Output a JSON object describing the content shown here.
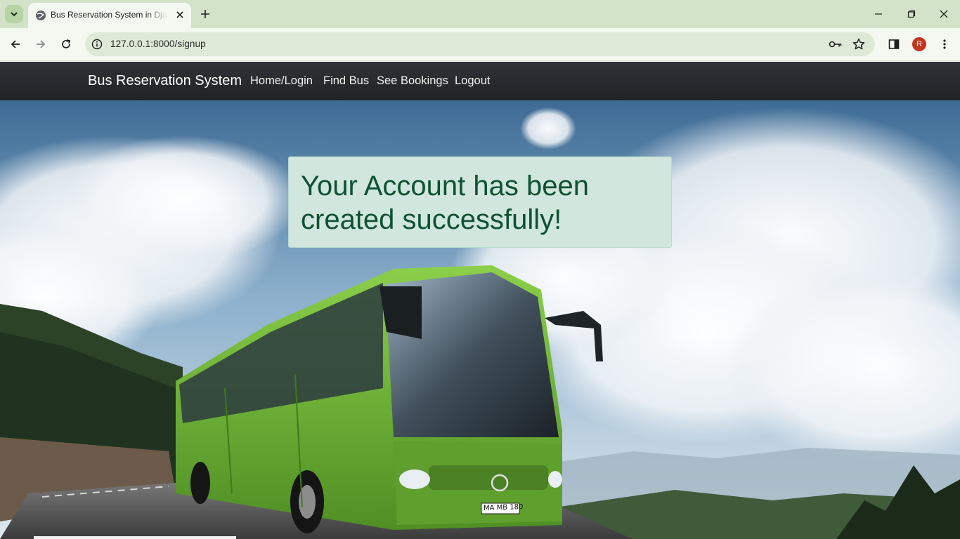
{
  "browser": {
    "tab_title": "Bus Reservation System in Djan",
    "url": "127.0.0.1:8000/signup",
    "profile_initial": "R"
  },
  "navbar": {
    "brand": "Bus Reservation System",
    "links": [
      "Home/Login",
      "Find Bus",
      "See Bookings",
      "Logout"
    ]
  },
  "alert": {
    "message": "Your Account has been created successfully!"
  },
  "hero": {
    "plate": "MA MB 180",
    "bus_color": "#6db43a"
  },
  "colors": {
    "tabbar": "#d3e3c9",
    "toolbar": "#f4f8f1",
    "navbar": "#212529",
    "alert_bg": "#d1e7dd",
    "alert_text": "#0f5132"
  }
}
